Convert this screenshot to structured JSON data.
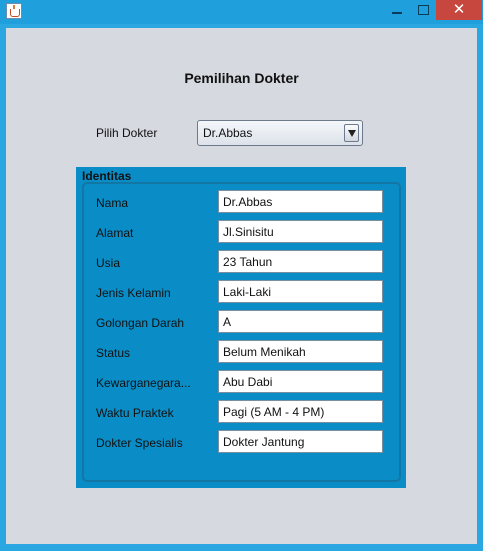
{
  "window": {
    "minimize_label": "",
    "maximize_label": "",
    "close_label": "✕"
  },
  "heading": "Pemilihan Dokter",
  "selector": {
    "label": "Pilih Dokter",
    "selected": "Dr.Abbas"
  },
  "panel": {
    "title": "Identitas",
    "rows": [
      {
        "label": "Nama",
        "value": "Dr.Abbas"
      },
      {
        "label": "Alamat",
        "value": "Jl.Sinisitu"
      },
      {
        "label": "Usia",
        "value": "23 Tahun"
      },
      {
        "label": "Jenis Kelamin",
        "value": "Laki-Laki"
      },
      {
        "label": "Golongan Darah",
        "value": "A"
      },
      {
        "label": "Status",
        "value": "Belum Menikah"
      },
      {
        "label": "Kewarganegara...",
        "value": "Abu Dabi"
      },
      {
        "label": "Waktu Praktek",
        "value": "Pagi (5 AM - 4 PM)"
      },
      {
        "label": "Dokter Spesialis",
        "value": "Dokter Jantung"
      }
    ]
  },
  "colors": {
    "panel_bg": "#0a8dc6",
    "client_bg": "#d6d9e0",
    "titlebar": "#1fa0dd",
    "close_button": "#c7473e"
  }
}
